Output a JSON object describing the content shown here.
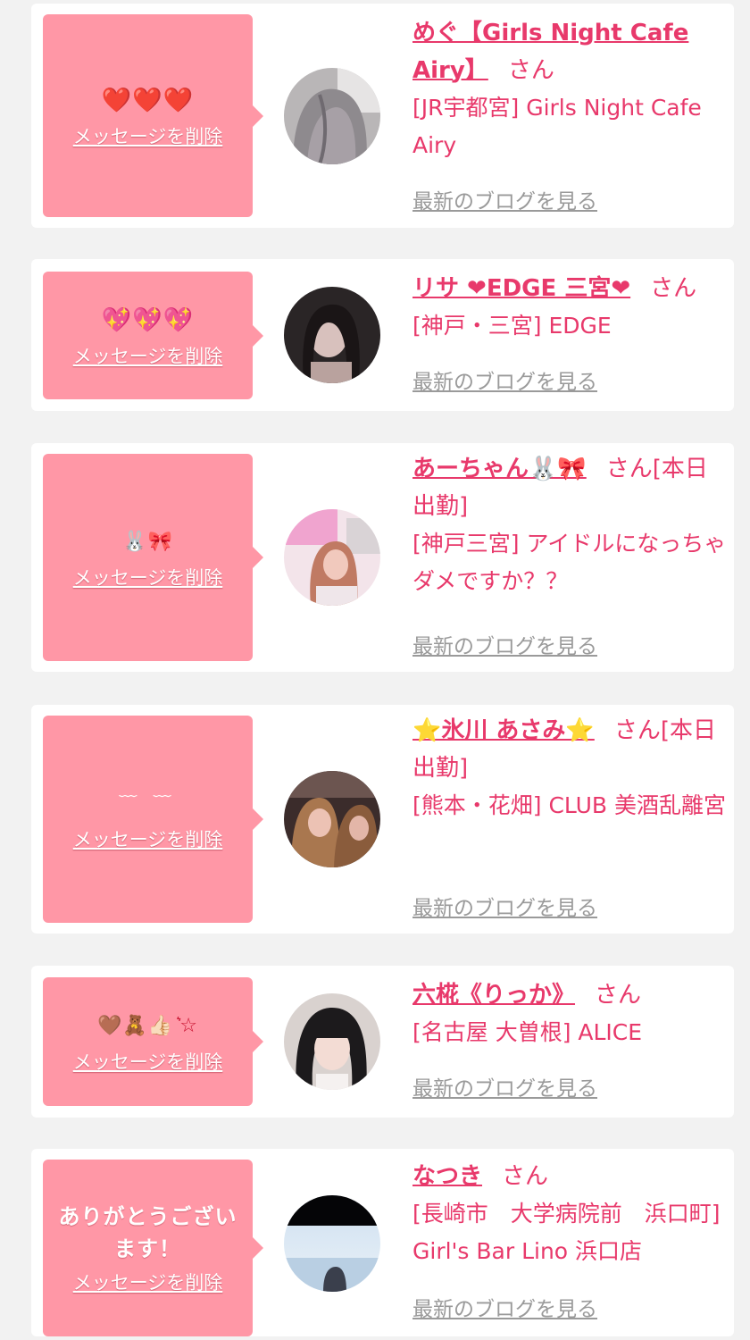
{
  "delete_label": "メッセージを削除",
  "blog_label": "最新のブログを見る",
  "entries": [
    {
      "message": "❤️❤️❤️",
      "avatar_icon": "hair-photo",
      "name": "めぐ【Girls Night Cafe Airy】",
      "san": "さん",
      "shop": "[JR宇都宮] Girls Night Cafe Airy"
    },
    {
      "message": "💖💖💖",
      "avatar_icon": "girl-photo",
      "name": "リサ ❤EDGE 三宮❤",
      "san": "さん",
      "shop": "[神戸・三宮] EDGE"
    },
    {
      "message": "🐰🎀",
      "avatar_icon": "girl-photo",
      "name": "あーちゃん🐰🎀",
      "san": "さん[本日出勤]",
      "shop": "[神戸三宮] アイドルになっちゃダメですか？？"
    },
    {
      "message": "﹋ ﹋",
      "avatar_icon": "girl-photo",
      "name": "⭐氷川 あさみ⭐",
      "san": "さん[本日出勤]",
      "shop": "[熊本・花畑] CLUB 美酒乱離宮"
    },
    {
      "message": "🤎🧸👍🏻 ͛☆",
      "avatar_icon": "girl-photo",
      "name": "六椛《りっか》",
      "san": "さん",
      "shop": "[名古屋 大曽根] ALICE"
    },
    {
      "message": "ありがとうございます！",
      "avatar_icon": "sea-photo",
      "name": "なつき",
      "san": "さん",
      "shop": "[長崎市　大学病院前　浜口町] Girl's Bar Lino 浜口店"
    }
  ],
  "colors": {
    "accent": "#e8396b",
    "bubble": "#ff97a6",
    "link_gray": "#9a9a9a",
    "background": "#f2f2f2"
  }
}
